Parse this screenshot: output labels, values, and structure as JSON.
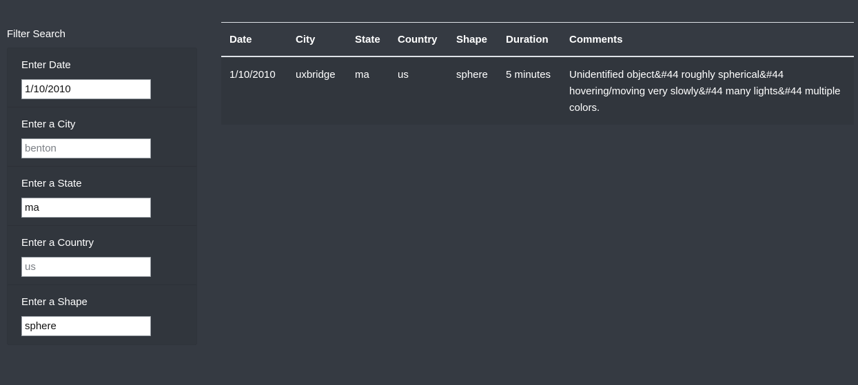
{
  "filter": {
    "title": "Filter Search",
    "fields": [
      {
        "label": "Enter Date",
        "value": "1/10/2010",
        "placeholder": ""
      },
      {
        "label": "Enter a City",
        "value": "",
        "placeholder": "benton"
      },
      {
        "label": "Enter a State",
        "value": "ma",
        "placeholder": ""
      },
      {
        "label": "Enter a Country",
        "value": "",
        "placeholder": "us"
      },
      {
        "label": "Enter a Shape",
        "value": "sphere",
        "placeholder": ""
      }
    ]
  },
  "table": {
    "headers": [
      "Date",
      "City",
      "State",
      "Country",
      "Shape",
      "Duration",
      "Comments"
    ],
    "rows": [
      [
        "1/10/2010",
        "uxbridge",
        "ma",
        "us",
        "sphere",
        "5 minutes",
        "Unidentified object&#44 roughly spherical&#44 hovering/moving very slowly&#44 many lights&#44 multiple colors."
      ]
    ]
  }
}
